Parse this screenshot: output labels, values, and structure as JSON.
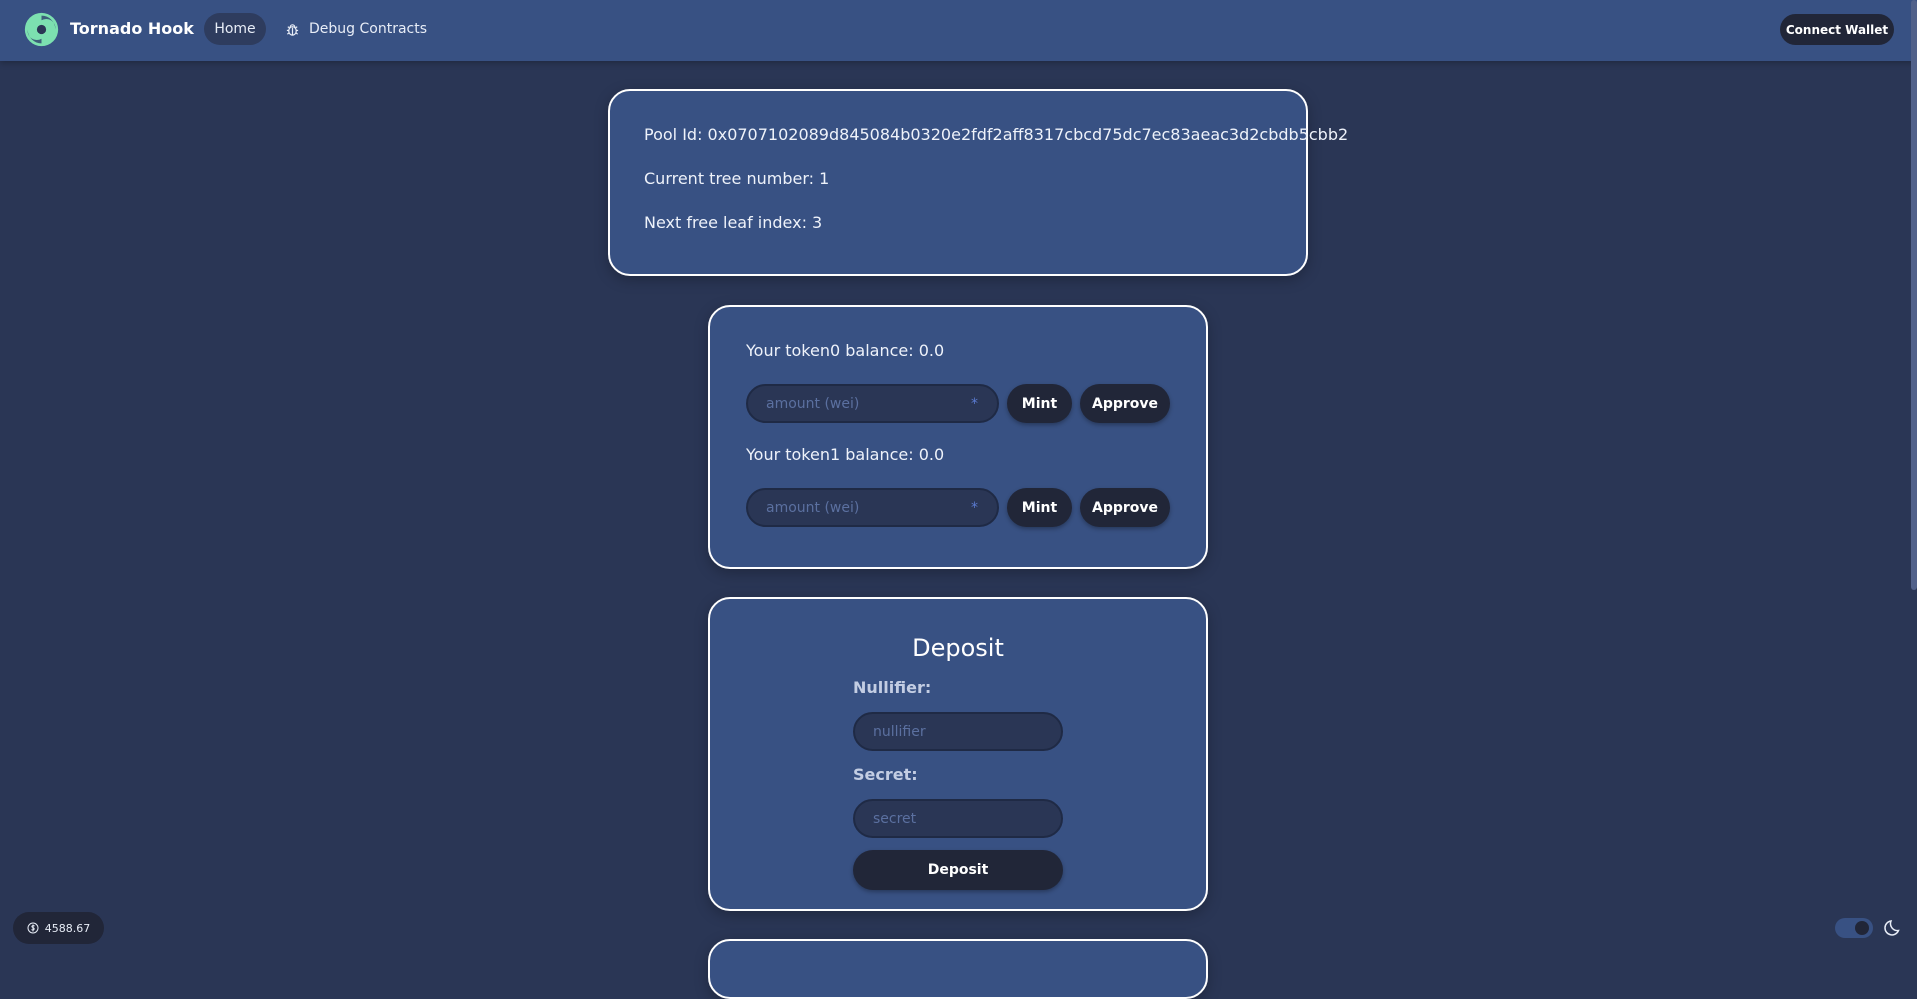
{
  "navbar": {
    "brand": "Tornado Hook",
    "links": {
      "home": "Home",
      "debug": "Debug Contracts"
    },
    "connect_wallet": "Connect Wallet",
    "brand_color": "#7ce0b0"
  },
  "pool": {
    "pool_id": "Pool Id: 0x0707102089d845084b0320e2fdf2aff8317cbcd75dc7ec83aeac3d2cbdb5cbb2",
    "tree_number": "Current tree number: 1",
    "next_leaf": "Next free leaf index: 3"
  },
  "tokens": {
    "token0_balance": "Your token0 balance: 0.0",
    "token1_balance": "Your token1 balance: 0.0",
    "amount_placeholder": "amount (wei)",
    "amount_suffix": "*",
    "mint_label": "Mint",
    "approve_label": "Approve"
  },
  "deposit": {
    "title": "Deposit",
    "nullifier_label": "Nullifier:",
    "nullifier_placeholder": "nullifier",
    "secret_label": "Secret:",
    "secret_placeholder": "secret",
    "button": "Deposit"
  },
  "footer": {
    "price": "4588.67",
    "theme": "dark"
  }
}
